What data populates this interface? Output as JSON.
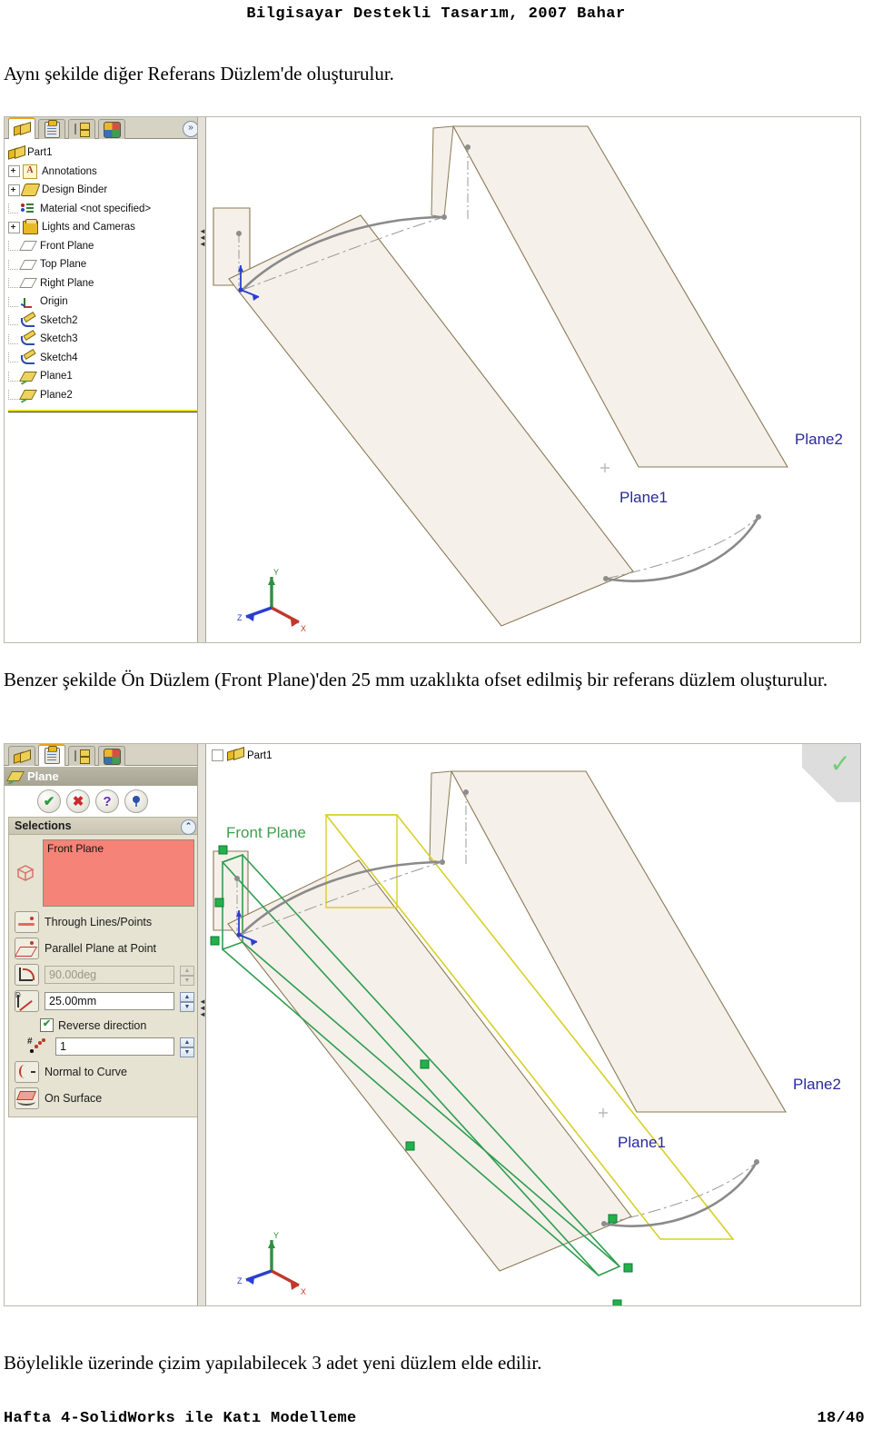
{
  "page": {
    "header": "Bilgisayar Destekli Tasarım, 2007 Bahar",
    "footer_left": "Hafta 4-SolidWorks ile Katı Modelleme",
    "footer_right": "18/40",
    "paragraph_1": "Aynı şekilde diğer Referans Düzlem'de oluşturulur.",
    "paragraph_2": "Benzer şekilde Ön Düzlem (Front Plane)'den 25 mm uzaklıkta ofset edilmiş bir referans düzlem oluşturulur.",
    "paragraph_3": "Böylelikle üzerinde çizim yapılabilecek 3 adet yeni düzlem elde edilir."
  },
  "colors": {
    "plane_fill": "#f5f0ea",
    "plane_edge": "#8a7a55",
    "label_blue": "#2a2a9c",
    "label_green": "#3fa04f",
    "selection_pink": "#f58377",
    "panel_bg": "#e7e3d2",
    "tab_active_accent": "#e8a317",
    "sketch_green": "#2f9e4f",
    "sketch_yellow": "#d9cf2a"
  },
  "shot1": {
    "tabs": [
      {
        "name": "feature-manager",
        "icon": "solidworks-part-icon",
        "active": true
      },
      {
        "name": "property-manager",
        "icon": "clipboard-icon",
        "active": false
      },
      {
        "name": "configuration-manager",
        "icon": "configuration-icon",
        "active": false
      },
      {
        "name": "display-manager",
        "icon": "display-sphere-icon",
        "active": false
      }
    ],
    "expand_label": "»",
    "tree": [
      {
        "label": "Part1",
        "icon": "part-icon",
        "expander": "none",
        "indent": 0
      },
      {
        "label": "Annotations",
        "icon": "annotations-icon",
        "expander": "plus",
        "indent": 1
      },
      {
        "label": "Design Binder",
        "icon": "design-binder-icon",
        "expander": "plus",
        "indent": 1
      },
      {
        "label": "Material <not specified>",
        "icon": "material-icon",
        "expander": "nub",
        "indent": 1
      },
      {
        "label": "Lights and Cameras",
        "icon": "lights-cameras-icon",
        "expander": "plus",
        "indent": 1
      },
      {
        "label": "Front Plane",
        "icon": "plane-icon",
        "expander": "nub",
        "indent": 1
      },
      {
        "label": "Top Plane",
        "icon": "plane-icon",
        "expander": "nub",
        "indent": 1
      },
      {
        "label": "Right Plane",
        "icon": "plane-icon",
        "expander": "nub",
        "indent": 1
      },
      {
        "label": "Origin",
        "icon": "origin-icon",
        "expander": "nub",
        "indent": 1
      },
      {
        "label": "Sketch2",
        "icon": "sketch-icon",
        "expander": "nub",
        "indent": 1
      },
      {
        "label": "Sketch3",
        "icon": "sketch-icon",
        "expander": "nub",
        "indent": 1
      },
      {
        "label": "Sketch4",
        "icon": "sketch-icon",
        "expander": "nub",
        "indent": 1
      },
      {
        "label": "Plane1",
        "icon": "new-plane-icon",
        "expander": "nub",
        "indent": 1
      },
      {
        "label": "Plane2",
        "icon": "new-plane-icon",
        "expander": "nub",
        "indent": 1
      }
    ],
    "viewport": {
      "labels": [
        {
          "text": "Plane2",
          "color": "#2a2a9c"
        },
        {
          "text": "Plane1",
          "color": "#2a2a9c"
        }
      ],
      "triad": {
        "x": "X",
        "y": "Y",
        "z": "Z"
      }
    }
  },
  "shot2": {
    "tabs": [
      {
        "name": "feature-manager",
        "icon": "solidworks-part-icon",
        "active": false
      },
      {
        "name": "property-manager",
        "icon": "clipboard-icon",
        "active": true
      },
      {
        "name": "configuration-manager",
        "icon": "configuration-icon",
        "active": false
      },
      {
        "name": "display-manager",
        "icon": "display-sphere-icon",
        "active": false
      }
    ],
    "property_manager": {
      "title": "Plane",
      "actions": [
        {
          "name": "ok-button",
          "glyph": "✔"
        },
        {
          "name": "cancel-button",
          "glyph": "✖"
        },
        {
          "name": "help-button",
          "glyph": "?"
        },
        {
          "name": "pin-button",
          "glyph": "📌"
        }
      ],
      "section_title": "Selections",
      "collapse_glyph": "⌃",
      "selection_value": "Front Plane",
      "through_lines_label": "Through Lines/Points",
      "parallel_plane_label": "Parallel Plane at Point",
      "angle_value": "90.00deg",
      "angle_enabled": false,
      "offset_value": "25.00mm",
      "offset_enabled": true,
      "reverse_direction_label": "Reverse direction",
      "reverse_direction_checked": true,
      "count_value": "1",
      "normal_to_curve_label": "Normal to Curve",
      "on_surface_label": "On Surface"
    },
    "viewport": {
      "tree_tip": "Part1",
      "labels": [
        {
          "text": "Front Plane",
          "color": "#3fa04f"
        },
        {
          "text": "Plane2",
          "color": "#2a2a9c"
        },
        {
          "text": "Plane1",
          "color": "#2a2a9c"
        }
      ],
      "confirm_corner_glyph": "✓",
      "triad": {
        "x": "X",
        "y": "Y",
        "z": "Z"
      }
    }
  }
}
